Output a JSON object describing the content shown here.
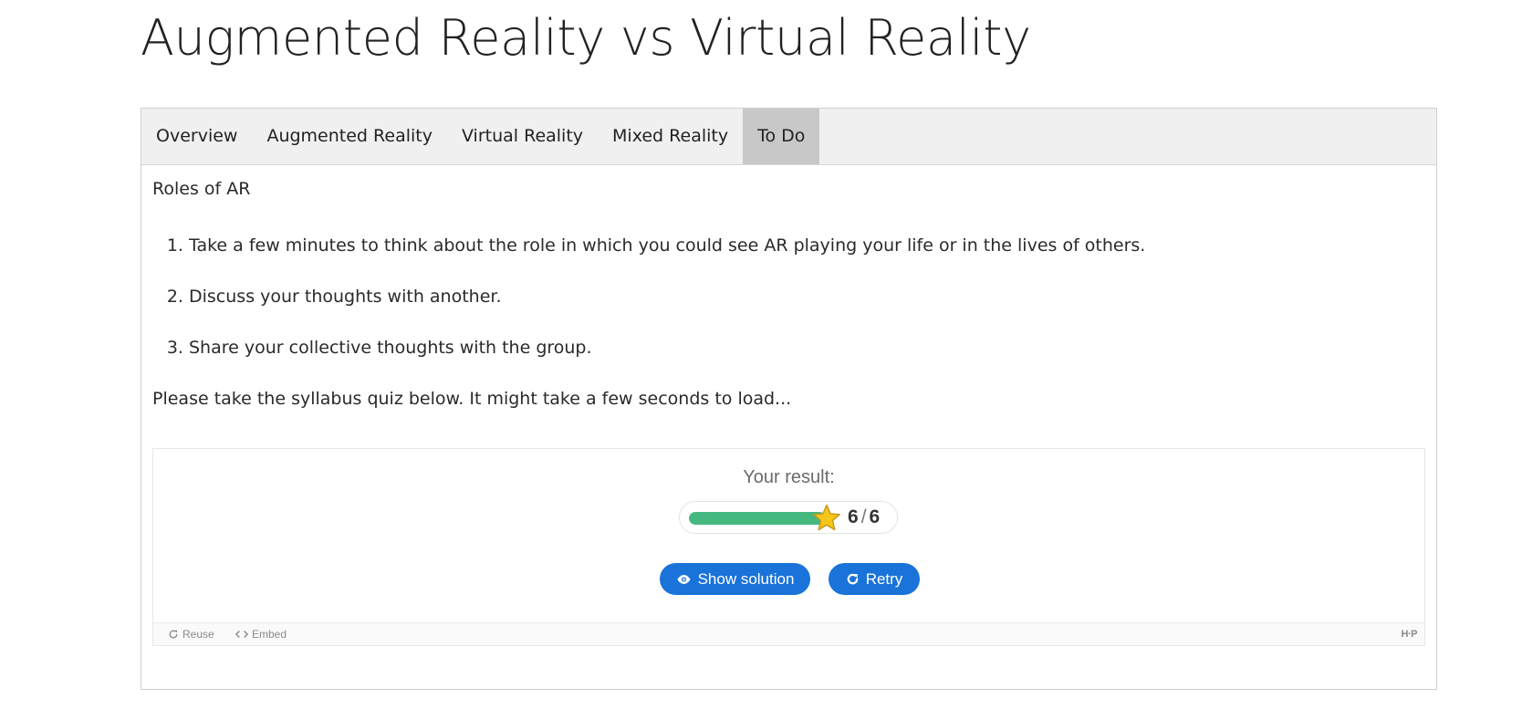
{
  "page": {
    "title": "Augmented Reality vs Virtual Reality"
  },
  "tabs": [
    {
      "label": "Overview",
      "active": false
    },
    {
      "label": "Augmented Reality",
      "active": false
    },
    {
      "label": "Virtual Reality",
      "active": false
    },
    {
      "label": "Mixed Reality",
      "active": false
    },
    {
      "label": "To Do",
      "active": true
    }
  ],
  "content": {
    "heading": "Roles of AR",
    "steps": [
      "Take a few minutes to think about the role in which you could see AR playing your life or in the lives of others.",
      "Discuss your thoughts with another.",
      "Share your collective thoughts with the group."
    ],
    "quiz_intro": "Please take the syllabus quiz below. It might take a few seconds to load..."
  },
  "quiz": {
    "result_label": "Your result:",
    "score": "6",
    "separator": "/",
    "max_score": "6",
    "progress_fraction": 1.0,
    "show_solution_label": "Show solution",
    "retry_label": "Retry",
    "footer": {
      "reuse_label": "Reuse",
      "embed_label": "Embed",
      "logo_text": "H·P"
    }
  },
  "colors": {
    "accent": "#1a73d9",
    "progress": "#45b880",
    "star": "#f6c619",
    "active_tab": "#c8c8c8",
    "tab_bar": "#f0f0f0"
  }
}
